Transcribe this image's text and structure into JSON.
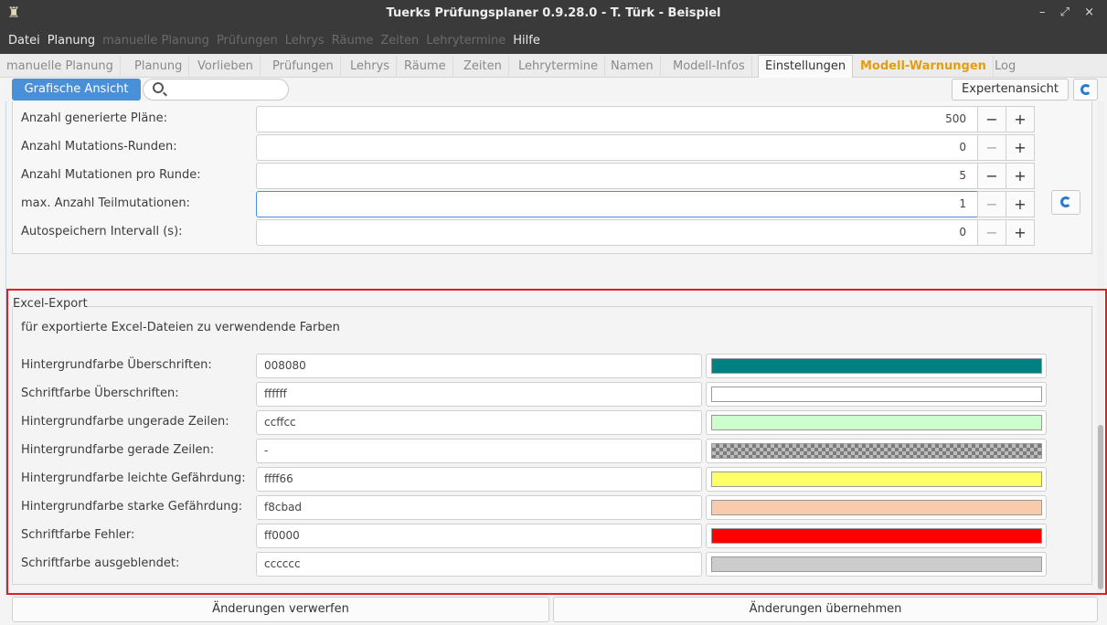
{
  "window": {
    "title": "Tuerks Prüfungsplaner 0.9.28.0 - T. Türk - Beispiel",
    "controls": "– ⤢ ×"
  },
  "menu": [
    {
      "label": "Datei",
      "enabled": true
    },
    {
      "label": "Planung",
      "enabled": true
    },
    {
      "label": "manuelle Planung",
      "enabled": false
    },
    {
      "label": "Prüfungen",
      "enabled": false
    },
    {
      "label": "Lehrys",
      "enabled": false
    },
    {
      "label": "Räume",
      "enabled": false
    },
    {
      "label": "Zeiten",
      "enabled": false
    },
    {
      "label": "Lehrytermine",
      "enabled": false
    },
    {
      "label": "Hilfe",
      "enabled": true
    }
  ],
  "tabs": [
    "manuelle Planung",
    "Planung",
    "Vorlieben",
    "Prüfungen",
    "Lehrys",
    "Räume",
    "Zeiten",
    "Lehrytermine",
    "Namen",
    "Modell-Infos",
    "Einstellungen",
    "Modell-Warnungen",
    "Log"
  ],
  "active_tab": "Einstellungen",
  "warning_tab": "Modell-Warnungen",
  "toolbar": {
    "graphic_view": "Grafische Ansicht",
    "search_value": "",
    "expert_view": "Expertenansicht"
  },
  "settings": [
    {
      "label": "Anzahl generierte Pläne:",
      "value": "500",
      "minus_enabled": true
    },
    {
      "label": "Anzahl Mutations-Runden:",
      "value": "0",
      "minus_enabled": false
    },
    {
      "label": "Anzahl Mutationen pro Runde:",
      "value": "5",
      "minus_enabled": true
    },
    {
      "label": "max. Anzahl Teilmutationen:",
      "value": "1",
      "minus_enabled": false
    },
    {
      "label": "Autospeichern Intervall (s):",
      "value": "0",
      "minus_enabled": false
    }
  ],
  "stepper": {
    "minus": "−",
    "plus": "+"
  },
  "excel_export": {
    "group_title": "Excel-Export",
    "description": "für exportierte Excel-Dateien zu verwendende Farben",
    "colors": [
      {
        "label": "Hintergrundfarbe Überschriften:",
        "value": "008080",
        "swatch": "#008080"
      },
      {
        "label": "Schriftfarbe Überschriften:",
        "value": "ffffff",
        "swatch": "#ffffff"
      },
      {
        "label": "Hintergrundfarbe ungerade Zeilen:",
        "value": "ccffcc",
        "swatch": "#ccffcc"
      },
      {
        "label": "Hintergrundfarbe gerade Zeilen:",
        "value": "-",
        "swatch": "transparent"
      },
      {
        "label": "Hintergrundfarbe leichte Gefährdung:",
        "value": "ffff66",
        "swatch": "#ffff66"
      },
      {
        "label": "Hintergrundfarbe starke Gefährdung:",
        "value": "f8cbad",
        "swatch": "#f8cbad"
      },
      {
        "label": "Schriftfarbe Fehler:",
        "value": "ff0000",
        "swatch": "#ff0000"
      },
      {
        "label": "Schriftfarbe ausgeblendet:",
        "value": "cccccc",
        "swatch": "#cccccc"
      }
    ]
  },
  "footer": {
    "discard": "Änderungen verwerfen",
    "apply": "Änderungen übernehmen"
  }
}
